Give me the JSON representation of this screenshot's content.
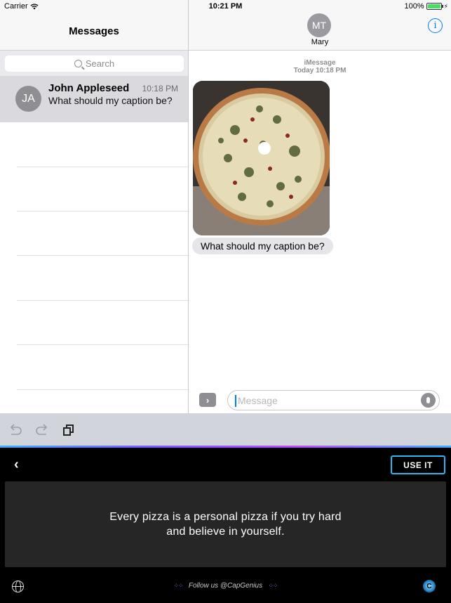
{
  "status_bar": {
    "carrier": "Carrier",
    "time": "10:21 PM",
    "battery": "100%"
  },
  "sidebar": {
    "title": "Messages",
    "search_placeholder": "Search",
    "conversations": [
      {
        "initials": "JA",
        "name": "John Appleseed",
        "time": "10:18 PM",
        "preview": "What should my caption be?"
      }
    ]
  },
  "conversation": {
    "contact_initials": "MT",
    "contact_name": "Mary",
    "service_label": "iMessage",
    "timestamp": "Today 10:18 PM",
    "message_text": "What should my caption be?",
    "input_placeholder": "Message"
  },
  "keyboard": {
    "use_it_label": "USE IT",
    "caption": "Every pizza is a personal pizza if you try hard and believe in yourself.",
    "follow_text": "Follow us @CapGenius",
    "accent_color": "#29b6f6"
  },
  "icons": [
    "wifi-icon",
    "battery-icon",
    "search-icon",
    "info-icon",
    "chevron-right-icon",
    "mic-icon",
    "undo-icon",
    "redo-icon",
    "copy-icon",
    "back-chevron-icon",
    "globe-icon",
    "capgenius-logo-icon"
  ]
}
